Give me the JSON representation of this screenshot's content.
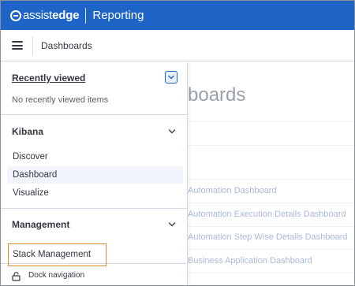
{
  "brand": {
    "logo_light": "assist",
    "logo_bold": "edge",
    "product": "Reporting",
    "color": "#1d64c6"
  },
  "header": {
    "menu_icon": "hamburger-icon",
    "breadcrumb": "Dashboards"
  },
  "background": {
    "page_title": "boards",
    "links": [
      "Automation Dashboard",
      "Automation Execution Details Dashboard",
      "Automation Step Wise Details Dashboard",
      "Business Application Dashboard"
    ]
  },
  "nav": {
    "recent": {
      "title": "Recently viewed",
      "empty_text": "No recently viewed items",
      "toggle_icon": "chevron-down-icon"
    },
    "kibana": {
      "title": "Kibana",
      "items": [
        "Discover",
        "Dashboard",
        "Visualize"
      ],
      "active": "Dashboard"
    },
    "management": {
      "title": "Management",
      "items": [
        "Stack Management"
      ],
      "highlight_color": "#e08a2c"
    },
    "dock": {
      "label": "Dock navigation",
      "icon": "dock-icon"
    }
  }
}
